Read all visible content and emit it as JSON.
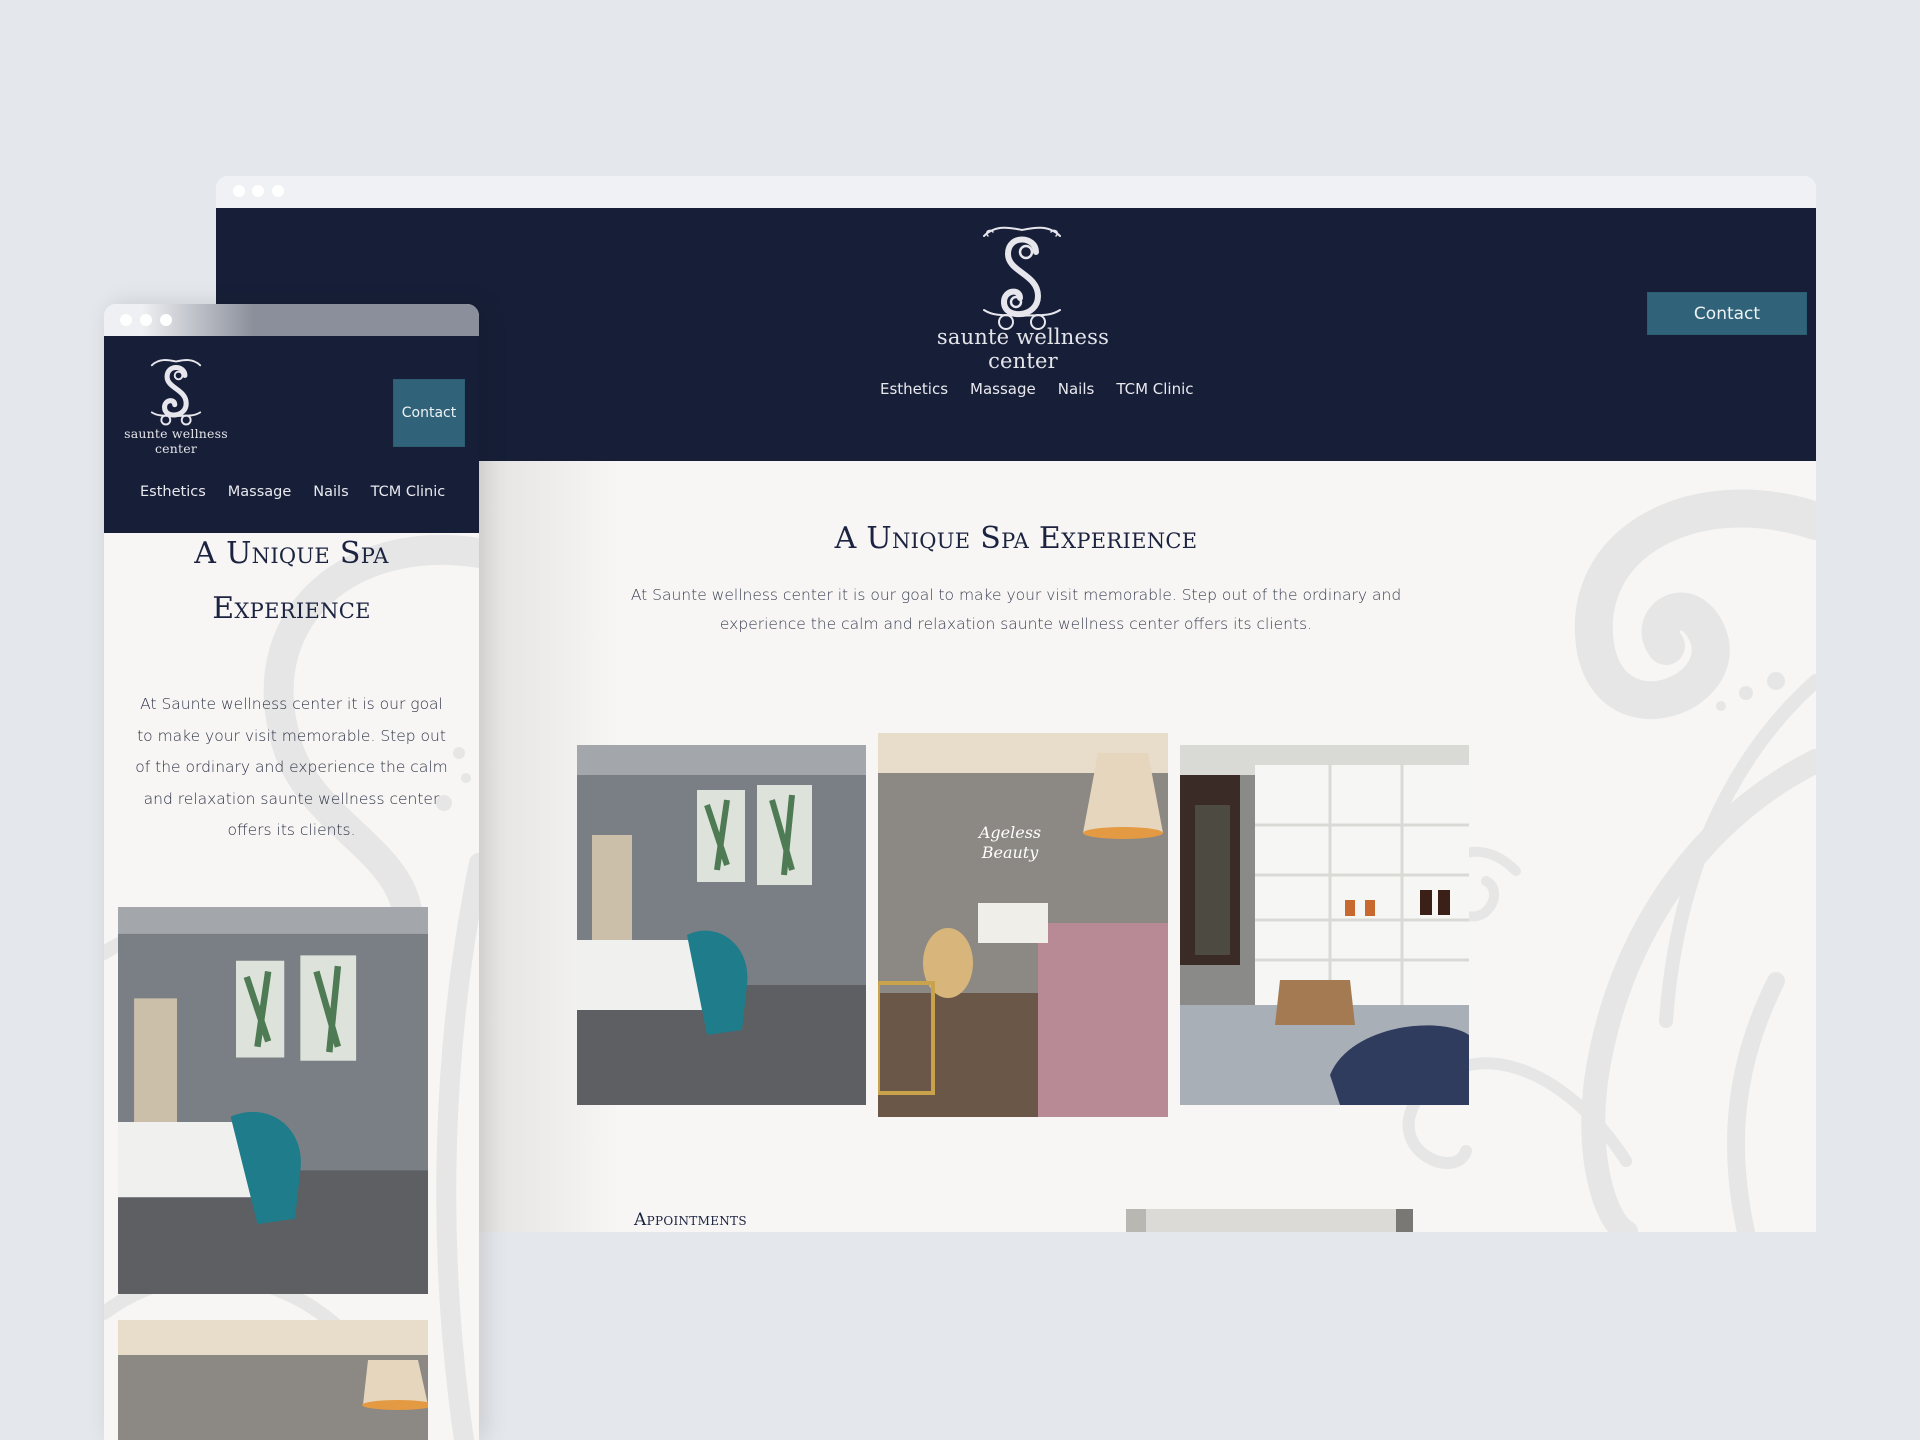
{
  "colors": {
    "page_background": "#e4e7eb",
    "header_navy": "#171f38",
    "contact_teal": "#30637a",
    "content_background": "#f7f6f4",
    "heading_text": "#1c2340"
  },
  "brand": {
    "name_line1": "saunte wellness",
    "name_line2": "center",
    "logo_icon": "ornate-s-monogram-icon"
  },
  "nav": {
    "items": [
      {
        "label": "Esthetics"
      },
      {
        "label": "Massage"
      },
      {
        "label": "Nails"
      },
      {
        "label": "TCM Clinic"
      }
    ],
    "contact_label": "Contact"
  },
  "hero": {
    "heading": "A Unique Spa Experience",
    "heading_mobile_line1": "A Unique Spa",
    "heading_mobile_line2": "Experience",
    "body_line1": "At Saunte wellness center it is our goal to make your visit memorable. Step out of the ordinary and",
    "body_line2": "experience the calm and relaxation saunte wellness center offers its clients.",
    "body_mobile_lines": [
      "At Saunte wellness center it is our goal",
      "to make your visit memorable. Step out",
      "of the ordinary and experience the calm",
      "and relaxation saunte wellness center",
      "offers its clients."
    ]
  },
  "gallery": {
    "photos": [
      {
        "alt": "Massage room with teal blanket and botanical paintings"
      },
      {
        "alt": "Esthetics room with neon Ageless Beauty sign and pink bed"
      },
      {
        "alt": "Retail area with white shelves, wooden table and blue chairs"
      }
    ],
    "neon_sign_line1": "Ageless",
    "neon_sign_line2": "Beauty"
  },
  "appointments": {
    "heading": "Appointments"
  }
}
